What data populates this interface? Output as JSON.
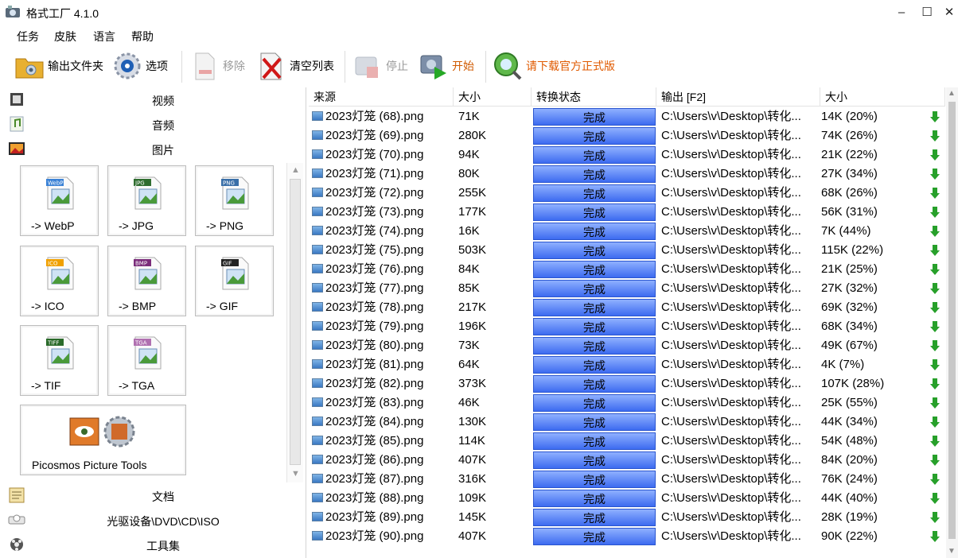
{
  "window": {
    "title": "格式工厂 4.1.0",
    "min": "–",
    "max": "☐",
    "close": "✕"
  },
  "menu": [
    "任务",
    "皮肤",
    "语言",
    "帮助"
  ],
  "toolbar": {
    "output_folder": "输出文件夹",
    "options": "选项",
    "remove": "移除",
    "clear_list": "清空列表",
    "stop": "停止",
    "start": "开始",
    "download": "请下载官方正式版"
  },
  "categories": {
    "video": "视频",
    "audio": "音频",
    "image": "图片",
    "document": "文档",
    "optical": "光驱设备\\DVD\\CD\\ISO",
    "tools": "工具集"
  },
  "tiles": [
    {
      "label": "-> WebP",
      "badge": "WebP",
      "color": "#3b82d6"
    },
    {
      "label": "-> JPG",
      "badge": "JPG",
      "color": "#2f6d2f"
    },
    {
      "label": "-> PNG",
      "badge": "PNG",
      "color": "#3a6fa8"
    },
    {
      "label": "-> ICO",
      "badge": "ICO",
      "color": "#f0a000"
    },
    {
      "label": "-> BMP",
      "badge": "BMP",
      "color": "#7a2c7a"
    },
    {
      "label": "-> GIF",
      "badge": "GIF",
      "color": "#222222"
    },
    {
      "label": "-> TIF",
      "badge": "TIFF",
      "color": "#2a6a2a"
    },
    {
      "label": "-> TGA",
      "badge": "TGA",
      "color": "#b070b0"
    }
  ],
  "picosmos": "Picosmos Picture Tools",
  "table": {
    "headers": {
      "source": "来源",
      "size": "大小",
      "status": "转换状态",
      "output": "输出 [F2]",
      "out_size": "大小"
    },
    "rows": [
      {
        "src": "2023灯笼 (68).png",
        "size": "71K",
        "status": "完成",
        "out": "C:\\Users\\v\\Desktop\\转化...",
        "osize": "14K  (20%)"
      },
      {
        "src": "2023灯笼 (69).png",
        "size": "280K",
        "status": "完成",
        "out": "C:\\Users\\v\\Desktop\\转化...",
        "osize": "74K  (26%)"
      },
      {
        "src": "2023灯笼 (70).png",
        "size": "94K",
        "status": "完成",
        "out": "C:\\Users\\v\\Desktop\\转化...",
        "osize": "21K  (22%)"
      },
      {
        "src": "2023灯笼 (71).png",
        "size": "80K",
        "status": "完成",
        "out": "C:\\Users\\v\\Desktop\\转化...",
        "osize": "27K  (34%)"
      },
      {
        "src": "2023灯笼 (72).png",
        "size": "255K",
        "status": "完成",
        "out": "C:\\Users\\v\\Desktop\\转化...",
        "osize": "68K  (26%)"
      },
      {
        "src": "2023灯笼 (73).png",
        "size": "177K",
        "status": "完成",
        "out": "C:\\Users\\v\\Desktop\\转化...",
        "osize": "56K  (31%)"
      },
      {
        "src": "2023灯笼 (74).png",
        "size": "16K",
        "status": "完成",
        "out": "C:\\Users\\v\\Desktop\\转化...",
        "osize": "7K  (44%)"
      },
      {
        "src": "2023灯笼 (75).png",
        "size": "503K",
        "status": "完成",
        "out": "C:\\Users\\v\\Desktop\\转化...",
        "osize": "115K  (22%)"
      },
      {
        "src": "2023灯笼 (76).png",
        "size": "84K",
        "status": "完成",
        "out": "C:\\Users\\v\\Desktop\\转化...",
        "osize": "21K  (25%)"
      },
      {
        "src": "2023灯笼 (77).png",
        "size": "85K",
        "status": "完成",
        "out": "C:\\Users\\v\\Desktop\\转化...",
        "osize": "27K  (32%)"
      },
      {
        "src": "2023灯笼 (78).png",
        "size": "217K",
        "status": "完成",
        "out": "C:\\Users\\v\\Desktop\\转化...",
        "osize": "69K  (32%)"
      },
      {
        "src": "2023灯笼 (79).png",
        "size": "196K",
        "status": "完成",
        "out": "C:\\Users\\v\\Desktop\\转化...",
        "osize": "68K  (34%)"
      },
      {
        "src": "2023灯笼 (80).png",
        "size": "73K",
        "status": "完成",
        "out": "C:\\Users\\v\\Desktop\\转化...",
        "osize": "49K  (67%)"
      },
      {
        "src": "2023灯笼 (81).png",
        "size": "64K",
        "status": "完成",
        "out": "C:\\Users\\v\\Desktop\\转化...",
        "osize": "4K  (7%)"
      },
      {
        "src": "2023灯笼 (82).png",
        "size": "373K",
        "status": "完成",
        "out": "C:\\Users\\v\\Desktop\\转化...",
        "osize": "107K  (28%)"
      },
      {
        "src": "2023灯笼 (83).png",
        "size": "46K",
        "status": "完成",
        "out": "C:\\Users\\v\\Desktop\\转化...",
        "osize": "25K  (55%)"
      },
      {
        "src": "2023灯笼 (84).png",
        "size": "130K",
        "status": "完成",
        "out": "C:\\Users\\v\\Desktop\\转化...",
        "osize": "44K  (34%)"
      },
      {
        "src": "2023灯笼 (85).png",
        "size": "114K",
        "status": "完成",
        "out": "C:\\Users\\v\\Desktop\\转化...",
        "osize": "54K  (48%)"
      },
      {
        "src": "2023灯笼 (86).png",
        "size": "407K",
        "status": "完成",
        "out": "C:\\Users\\v\\Desktop\\转化...",
        "osize": "84K  (20%)"
      },
      {
        "src": "2023灯笼 (87).png",
        "size": "316K",
        "status": "完成",
        "out": "C:\\Users\\v\\Desktop\\转化...",
        "osize": "76K  (24%)"
      },
      {
        "src": "2023灯笼 (88).png",
        "size": "109K",
        "status": "完成",
        "out": "C:\\Users\\v\\Desktop\\转化...",
        "osize": "44K  (40%)"
      },
      {
        "src": "2023灯笼 (89).png",
        "size": "145K",
        "status": "完成",
        "out": "C:\\Users\\v\\Desktop\\转化...",
        "osize": "28K  (19%)"
      },
      {
        "src": "2023灯笼 (90).png",
        "size": "407K",
        "status": "完成",
        "out": "C:\\Users\\v\\Desktop\\转化...",
        "osize": "90K  (22%)"
      }
    ]
  }
}
